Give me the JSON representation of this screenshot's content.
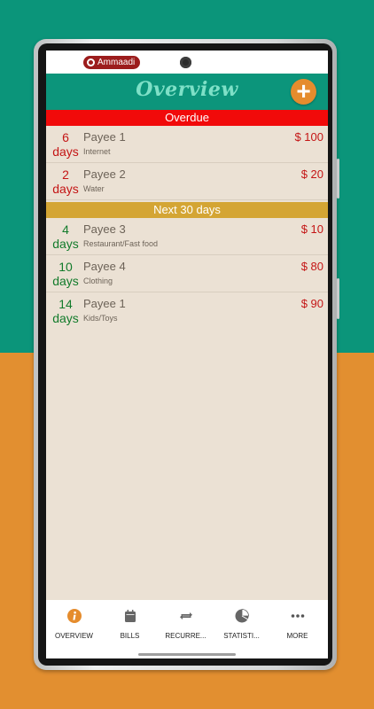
{
  "status_bar": {
    "brand": "Ammaadi"
  },
  "app_bar": {
    "title": "Overview",
    "add_label": "+"
  },
  "sections": [
    {
      "title": "Overdue",
      "items": [
        {
          "days": "6",
          "days_label": "days",
          "payee": "Payee 1",
          "category": "Internet",
          "amount": "$ 100"
        },
        {
          "days": "2",
          "days_label": "days",
          "payee": "Payee 2",
          "category": "Water",
          "amount": "$ 20"
        }
      ]
    },
    {
      "title": "Next 30 days",
      "items": [
        {
          "days": "4",
          "days_label": "days",
          "payee": "Payee 3",
          "category": "Restaurant/Fast food",
          "amount": "$ 10"
        },
        {
          "days": "10",
          "days_label": "days",
          "payee": "Payee 4",
          "category": "Clothing",
          "amount": "$ 80"
        },
        {
          "days": "14",
          "days_label": "days",
          "payee": "Payee 1",
          "category": "Kids/Toys",
          "amount": "$ 90"
        }
      ]
    }
  ],
  "bottom_nav": [
    {
      "label": "OVERVIEW",
      "icon": "info-icon",
      "active": true
    },
    {
      "label": "BILLS",
      "icon": "bills-icon"
    },
    {
      "label": "RECURRE...",
      "icon": "recurring-icon"
    },
    {
      "label": "STATISTI...",
      "icon": "pie-chart-icon"
    },
    {
      "label": "MORE",
      "icon": "more-icon"
    }
  ],
  "colors": {
    "app_bar": "#0c957b",
    "overdue": "#f10a0a",
    "next_30": "#d4a534",
    "accent": "#e58c2d",
    "amount_red": "#c41515",
    "days_green": "#127b2b"
  }
}
